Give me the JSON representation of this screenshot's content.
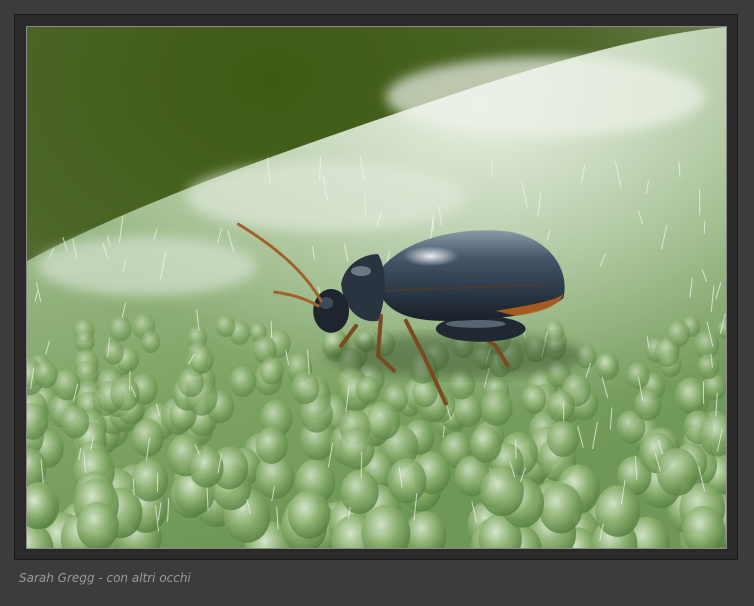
{
  "photo": {
    "subject": "beetle-on-leaf",
    "colors": {
      "frame": "#3c3c3c",
      "mat": "#2a2a2a",
      "leaf": "#8fb07a",
      "beetle": "#2c3a48",
      "background_green": "#3f5a1e"
    }
  },
  "caption": {
    "text": "Sarah Gregg - con altri occhi"
  }
}
